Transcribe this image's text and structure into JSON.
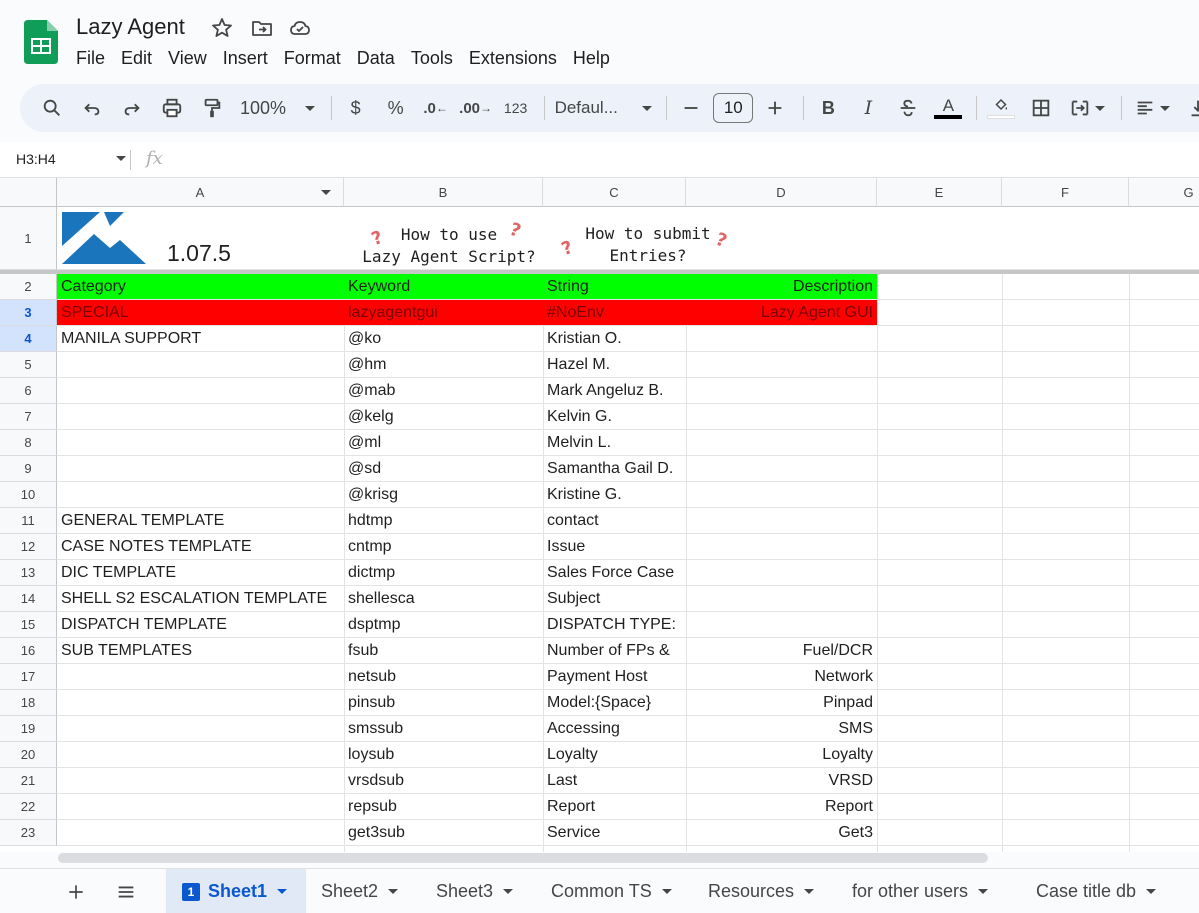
{
  "header": {
    "title": "Lazy Agent",
    "menu": [
      "File",
      "Edit",
      "View",
      "Insert",
      "Format",
      "Data",
      "Tools",
      "Extensions",
      "Help"
    ]
  },
  "toolbar": {
    "zoom": "100%",
    "currency": "$",
    "percent": "%",
    "decrease_decimal": ".0",
    "increase_decimal": ".00",
    "more_formats": "123",
    "font": "Defaul...",
    "font_size": "10",
    "bold": "B",
    "italic": "I",
    "text_color_letter": "A"
  },
  "formula_bar": {
    "name_box": "H3:H4",
    "fx": "fx"
  },
  "columns": [
    "A",
    "B",
    "C",
    "D",
    "E",
    "F",
    "G"
  ],
  "row1": {
    "version": "1.07.5",
    "how_to_use_line1": "How to use",
    "how_to_use_line2": "Lazy Agent Script?",
    "how_to_submit_line1": "How to submit",
    "how_to_submit_line2": "Entries?"
  },
  "rows": [
    {
      "n": "2",
      "a": "Category",
      "b": "Keyword",
      "c": "String",
      "d": "Description"
    },
    {
      "n": "3",
      "a": "SPECIAL",
      "b": "lazyagentgui",
      "c": "#NoEnv",
      "d": "Lazy Agent GUI"
    },
    {
      "n": "4",
      "a": "MANILA SUPPORT",
      "b": "@ko",
      "c": "Kristian O.",
      "d": ""
    },
    {
      "n": "5",
      "a": "",
      "b": "@hm",
      "c": "Hazel M.",
      "d": ""
    },
    {
      "n": "6",
      "a": "",
      "b": "@mab",
      "c": "Mark Angeluz B.",
      "d": ""
    },
    {
      "n": "7",
      "a": "",
      "b": "@kelg",
      "c": "Kelvin G.",
      "d": ""
    },
    {
      "n": "8",
      "a": "",
      "b": "@ml",
      "c": "Melvin L.",
      "d": ""
    },
    {
      "n": "9",
      "a": "",
      "b": "@sd",
      "c": "Samantha Gail D.",
      "d": ""
    },
    {
      "n": "10",
      "a": "",
      "b": "@krisg",
      "c": "Kristine G.",
      "d": ""
    },
    {
      "n": "11",
      "a": "GENERAL TEMPLATE",
      "b": "hdtmp",
      "c": "contact",
      "d": ""
    },
    {
      "n": "12",
      "a": "CASE NOTES TEMPLATE",
      "b": "cntmp",
      "c": "Issue",
      "d": ""
    },
    {
      "n": "13",
      "a": "DIC TEMPLATE",
      "b": "dictmp",
      "c": "Sales Force Case",
      "d": ""
    },
    {
      "n": "14",
      "a": "SHELL S2 ESCALATION TEMPLATE",
      "b": "shellesca",
      "c": "Subject",
      "d": ""
    },
    {
      "n": "15",
      "a": "DISPATCH TEMPLATE",
      "b": "dsptmp",
      "c": "DISPATCH TYPE:",
      "d": ""
    },
    {
      "n": "16",
      "a": "SUB TEMPLATES",
      "b": "fsub",
      "c": "Number of FPs &",
      "d": "Fuel/DCR"
    },
    {
      "n": "17",
      "a": "",
      "b": "netsub",
      "c": "Payment Host",
      "d": "Network"
    },
    {
      "n": "18",
      "a": "",
      "b": "pinsub",
      "c": "Model:{Space}",
      "d": "Pinpad"
    },
    {
      "n": "19",
      "a": "",
      "b": "smssub",
      "c": "Accessing",
      "d": "SMS"
    },
    {
      "n": "20",
      "a": "",
      "b": "loysub",
      "c": "Loyalty",
      "d": "Loyalty"
    },
    {
      "n": "21",
      "a": "",
      "b": "vrsdsub",
      "c": "Last",
      "d": "VRSD"
    },
    {
      "n": "22",
      "a": "",
      "b": "repsub",
      "c": "Report",
      "d": "Report"
    },
    {
      "n": "23",
      "a": "",
      "b": "get3sub",
      "c": "Service",
      "d": "Get3"
    }
  ],
  "colors": {
    "header_row_fill": "#00ff00",
    "special_row_fill": "#ff0000",
    "accent": "#0b57d0"
  },
  "sheets": {
    "active_index": "1",
    "tabs": [
      "Sheet1",
      "Sheet2",
      "Sheet3",
      "Common TS",
      "Resources",
      "for other users",
      "Case title db"
    ]
  }
}
